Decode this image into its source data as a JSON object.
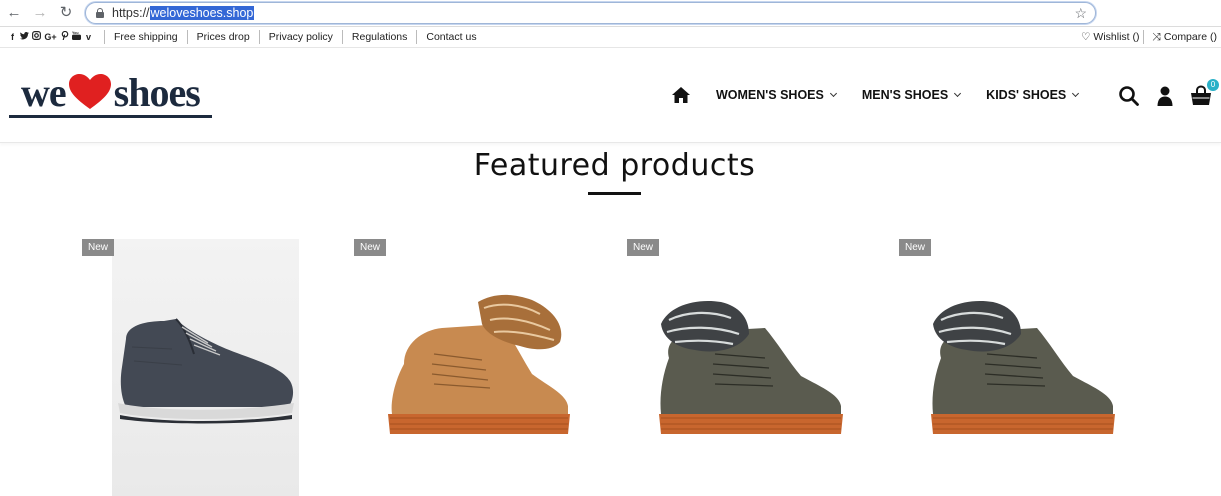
{
  "browser": {
    "url_prefix": "https://",
    "url_selected": "weloveshoes.shop"
  },
  "topbar": {
    "social": [
      "f",
      "t",
      "ig",
      "G+",
      "p",
      "yt",
      "v"
    ],
    "links": [
      "Free shipping",
      "Prices drop",
      "Privacy policy",
      "Regulations",
      "Contact us"
    ],
    "wishlist": "Wishlist ()",
    "compare": "Compare ()"
  },
  "header": {
    "logo": {
      "left": "we",
      "right": "shoes",
      "heart_color": "#e02020"
    },
    "nav": [
      "WOMEN'S SHOES",
      "MEN'S SHOES",
      "KIDS' SHOES"
    ],
    "cart_count": "0"
  },
  "featured": {
    "title": "Featured products",
    "products": [
      {
        "badge": "New",
        "image": "dark grey men's lace-up boot"
      },
      {
        "badge": "New",
        "image": "tan suede boot with fur collar"
      },
      {
        "badge": "New",
        "image": "khaki boot with grey fur collar"
      },
      {
        "badge": "New",
        "image": "khaki boot with grey fur collar"
      }
    ]
  },
  "colors": {
    "accent": "#2ab1c8",
    "logo_navy": "#1c2a3e",
    "badge_grey": "#8a8a8a",
    "url_highlight": "#3367d6"
  }
}
